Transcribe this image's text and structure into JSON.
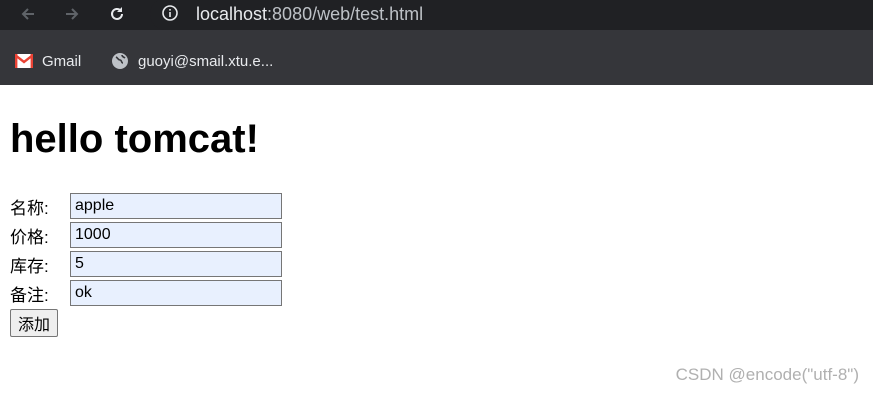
{
  "browser": {
    "url_host": "localhost",
    "url_path": ":8080/web/test.html",
    "bookmarks": [
      {
        "label": "Gmail",
        "icon": "gmail-icon"
      },
      {
        "label": "guoyi@smail.xtu.e...",
        "icon": "globe-icon"
      }
    ]
  },
  "page": {
    "title": "hello tomcat!",
    "form": {
      "fields": [
        {
          "label": "名称:",
          "value": "apple"
        },
        {
          "label": "价格:",
          "value": "1000"
        },
        {
          "label": "库存:",
          "value": "5"
        },
        {
          "label": "备注:",
          "value": "ok"
        }
      ],
      "submit_label": "添加"
    }
  },
  "watermark": "CSDN @encode(\"utf-8\")",
  "colors": {
    "chrome_dark": "#202124",
    "chrome_bar": "#35363a",
    "autofill_bg": "#e8f0fe"
  }
}
